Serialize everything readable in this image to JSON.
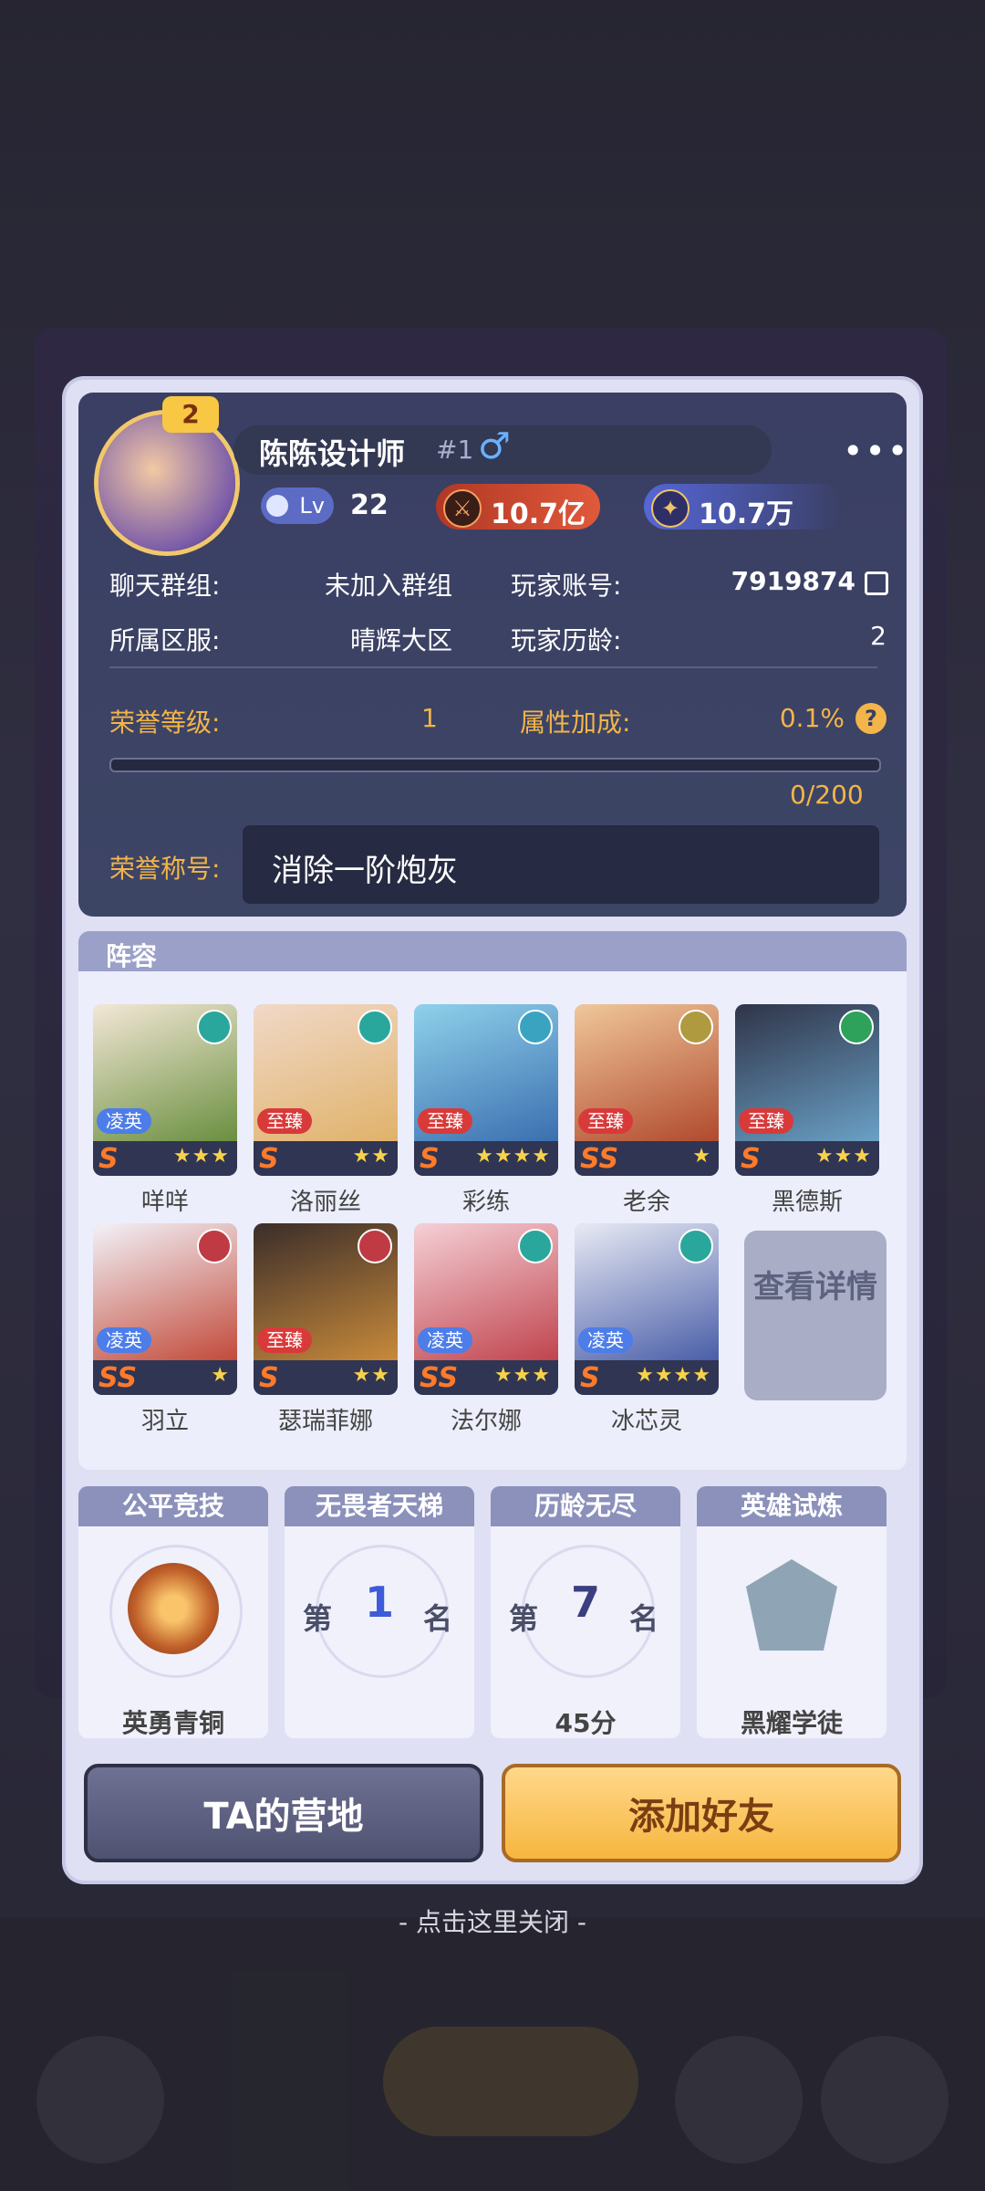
{
  "player": {
    "name": "陈陈设计师",
    "rank": "#1",
    "gender_symbol": "♂",
    "level_badge": "Lv",
    "level": "22",
    "more": "•••",
    "avatar_badge": "2"
  },
  "stats": {
    "power": "10.7亿",
    "points": "10.7万"
  },
  "info": {
    "chat_group_label": "聊天群组:",
    "chat_group_value": "未加入群组",
    "account_label": "玩家账号:",
    "account_value": "7919874",
    "server_label": "所属区服:",
    "server_value": "晴辉大区",
    "age_label": "玩家历龄:",
    "age_value": "2"
  },
  "honor": {
    "level_label": "荣誉等级:",
    "level_value": "1",
    "bonus_label": "属性加成:",
    "bonus_value": "0.1%",
    "progress_text": "0/200",
    "progress_fraction": 0,
    "title_label": "荣誉称号:",
    "title_value": "消除一阶炮灰"
  },
  "lineup": {
    "header": "阵容",
    "heroes": [
      {
        "name": "咩咩",
        "tag": "凌英",
        "tag_color": "blue",
        "rank": "S",
        "stars": "★★★"
      },
      {
        "name": "洛丽丝",
        "tag": "至臻",
        "tag_color": "red",
        "rank": "S",
        "stars": "★★"
      },
      {
        "name": "彩练",
        "tag": "至臻",
        "tag_color": "red",
        "rank": "S",
        "stars": "★★★★"
      },
      {
        "name": "老余",
        "tag": "至臻",
        "tag_color": "red",
        "rank": "SS",
        "stars": "★"
      },
      {
        "name": "黑德斯",
        "tag": "至臻",
        "tag_color": "red",
        "rank": "S",
        "stars": "★★★"
      },
      {
        "name": "羽立",
        "tag": "凌英",
        "tag_color": "blue",
        "rank": "SS",
        "stars": "★"
      },
      {
        "name": "瑟瑞菲娜",
        "tag": "至臻",
        "tag_color": "red",
        "rank": "S",
        "stars": "★★"
      },
      {
        "name": "法尔娜",
        "tag": "凌英",
        "tag_color": "blue",
        "rank": "SS",
        "stars": "★★★"
      },
      {
        "name": "冰芯灵",
        "tag": "凌英",
        "tag_color": "blue",
        "rank": "S",
        "stars": "★★★★"
      }
    ],
    "view_more": "查看详情"
  },
  "ranks": [
    {
      "title": "公平竞技",
      "footer": "英勇青铜"
    },
    {
      "title": "无畏者天梯",
      "prefix": "第",
      "num": "1",
      "suffix": "名",
      "footer": ""
    },
    {
      "title": "历龄无尽",
      "prefix": "第",
      "num": "7",
      "suffix": "名",
      "footer": "45分"
    },
    {
      "title": "英雄试炼",
      "footer": "黑耀学徒"
    }
  ],
  "buttons": {
    "camp": "TA的营地",
    "add_friend": "添加好友"
  },
  "close_hint": "- 点击这里关闭 -",
  "colors": {
    "accent_gold": "#f3b54a",
    "panel_dark": "#3a3f63",
    "tag_red": "#d83a3a",
    "tag_blue": "#4d7de8"
  }
}
